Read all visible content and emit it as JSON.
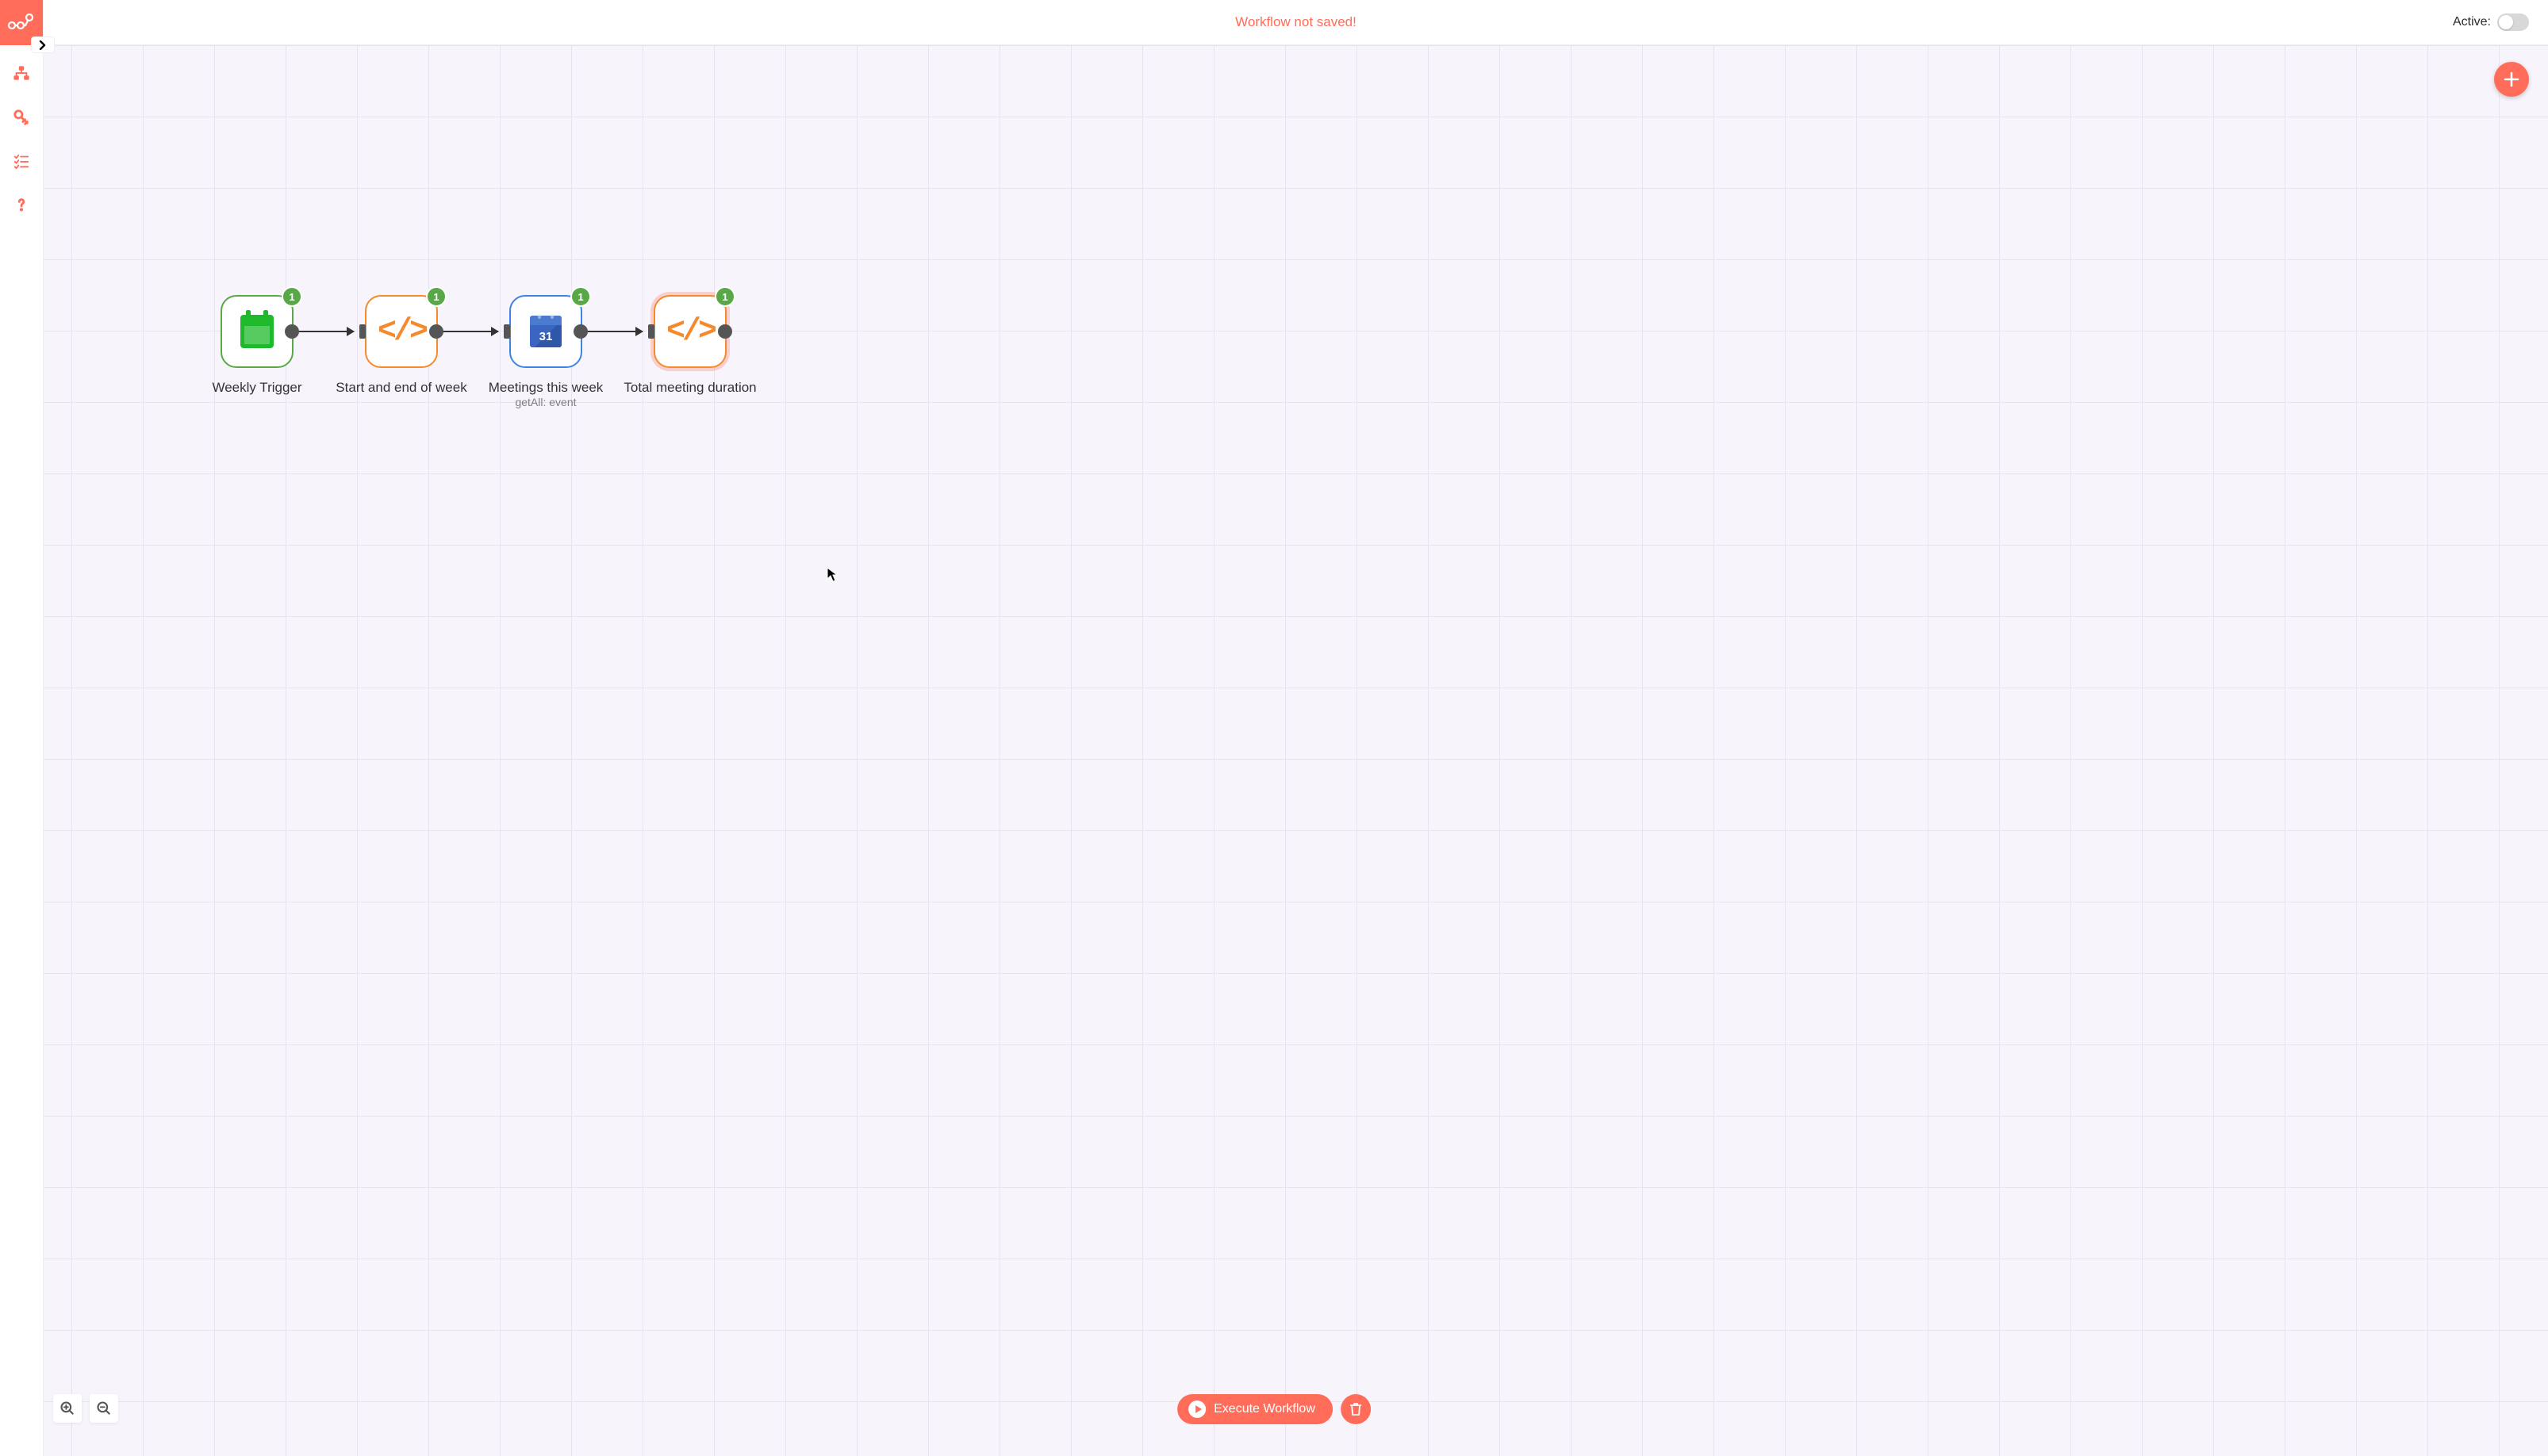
{
  "header": {
    "status": "Workflow not saved!",
    "active_label": "Active:",
    "active_on": false
  },
  "sidebar": {
    "items": [
      {
        "name": "workflows-icon"
      },
      {
        "name": "credentials-icon"
      },
      {
        "name": "executions-icon"
      },
      {
        "name": "help-icon"
      }
    ]
  },
  "canvas": {
    "nodes": [
      {
        "id": "n1",
        "label": "Weekly Trigger",
        "sublabel": "",
        "badge": "1",
        "border": "green",
        "icon": "calendar",
        "selected": false,
        "has_input": false
      },
      {
        "id": "n2",
        "label": "Start and end of week",
        "sublabel": "",
        "badge": "1",
        "border": "orange",
        "icon": "code",
        "selected": false,
        "has_input": true
      },
      {
        "id": "n3",
        "label": "Meetings this week",
        "sublabel": "getAll: event",
        "badge": "1",
        "border": "blue",
        "icon": "google-calendar",
        "selected": false,
        "has_input": true
      },
      {
        "id": "n4",
        "label": "Total meeting duration",
        "sublabel": "",
        "badge": "1",
        "border": "orange",
        "icon": "code",
        "selected": true,
        "has_input": true
      }
    ],
    "gcal_day": "31"
  },
  "bottom": {
    "execute_label": "Execute Workflow"
  }
}
